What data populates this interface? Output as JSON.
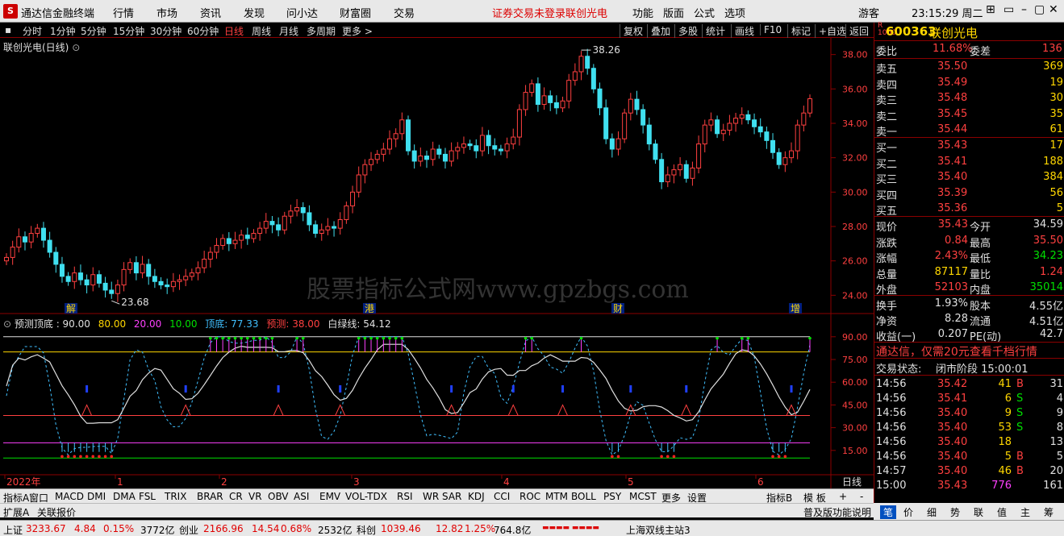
{
  "menubar": {
    "app_title": "通达信金融终端",
    "items": [
      "行情",
      "市场",
      "资讯",
      "发现",
      "问小达",
      "财富圈",
      "交易"
    ],
    "warning": "证券交易未登录",
    "warning_stock": "联创光电",
    "right_items": [
      "功能",
      "版面",
      "公式",
      "选项"
    ],
    "user": "游客",
    "clock": "23:15:29 周二",
    "win_buttons": [
      "⊞",
      "▭",
      "–",
      "▢",
      "✕"
    ]
  },
  "periodbar": {
    "periods": [
      "分时",
      "1分钟",
      "5分钟",
      "15分钟",
      "30分钟",
      "60分钟",
      "日线",
      "周线",
      "月线",
      "多周期",
      "更多 >"
    ],
    "active": "日线",
    "tools": [
      "复权",
      "叠加",
      "多股",
      "统计",
      "画线",
      "F10",
      "标记",
      "+自选",
      "返回"
    ]
  },
  "price_chart": {
    "title": "联创光电(日线)",
    "high_label": "38.26",
    "low_label": "23.68",
    "yaxis": [
      "38.00",
      "36.00",
      "34.00",
      "32.00",
      "30.00",
      "28.00",
      "26.00",
      "24.00"
    ],
    "markers": [
      "解",
      "港",
      "财",
      "增"
    ],
    "watermark": "股票指标公式网www.gpzbgs.com"
  },
  "indicator": {
    "name": "预测顶底",
    "legend": [
      {
        "text": "预测顶底 : 90.00",
        "color": "#e0e0e0"
      },
      {
        "text": "80.00",
        "color": "#ffd700"
      },
      {
        "text": "20.00",
        "color": "#ff40ff"
      },
      {
        "text": "10.00",
        "color": "#00e000"
      },
      {
        "text": "顶底: 77.33",
        "color": "#40c0ff"
      },
      {
        "text": "预测: 38.00",
        "color": "#ff4040"
      },
      {
        "text": "白绿线: 54.12",
        "color": "#e0e0e0"
      }
    ],
    "yaxis": [
      "90.00",
      "75.00",
      "60.00",
      "45.00",
      "30.00",
      "15.00"
    ]
  },
  "xaxis": {
    "labels": [
      "2022年",
      "1",
      "2",
      "3",
      "4",
      "5",
      "6"
    ],
    "period_label": "日线"
  },
  "ind_tabs": {
    "items": [
      "指标A",
      "窗口",
      "MACD",
      "DMI",
      "DMA",
      "FSL",
      "TRIX",
      "BRAR",
      "CR",
      "VR",
      "OBV",
      "ASI",
      "EMV",
      "VOL-TDX",
      "RSI",
      "WR",
      "SAR",
      "KDJ",
      "CCI",
      "ROC",
      "MTM",
      "BOLL",
      "PSY",
      "MCST",
      "更多",
      "设置"
    ],
    "right": [
      "指标B",
      "模 板",
      "+",
      "-"
    ]
  },
  "ext_bar": {
    "items": [
      "扩展A",
      "关联报价"
    ],
    "right": "普及版功能说明"
  },
  "quote_panel": {
    "badge_r": "R",
    "badge_num": "1000",
    "code": "600363",
    "name": "联创光电",
    "weibi_label": "委比",
    "weibi": "11.68%",
    "weicha_label": "委差",
    "weicha": "136",
    "asks": [
      {
        "label": "卖五",
        "price": "35.50",
        "vol": "369"
      },
      {
        "label": "卖四",
        "price": "35.49",
        "vol": "19"
      },
      {
        "label": "卖三",
        "price": "35.48",
        "vol": "30"
      },
      {
        "label": "卖二",
        "price": "35.45",
        "vol": "35"
      },
      {
        "label": "卖一",
        "price": "35.44",
        "vol": "61"
      }
    ],
    "bids": [
      {
        "label": "买一",
        "price": "35.43",
        "vol": "17"
      },
      {
        "label": "买二",
        "price": "35.41",
        "vol": "188"
      },
      {
        "label": "买三",
        "price": "35.40",
        "vol": "384"
      },
      {
        "label": "买四",
        "price": "35.39",
        "vol": "56"
      },
      {
        "label": "买五",
        "price": "35.36",
        "vol": "5"
      }
    ],
    "stats": [
      {
        "l1": "现价",
        "v1": "35.43",
        "c1": "red",
        "l2": "今开",
        "v2": "34.59",
        "c2": "wht"
      },
      {
        "l1": "涨跌",
        "v1": "0.84",
        "c1": "red",
        "l2": "最高",
        "v2": "35.50",
        "c2": "red"
      },
      {
        "l1": "涨幅",
        "v1": "2.43%",
        "c1": "red",
        "l2": "最低",
        "v2": "34.23",
        "c2": "grn"
      },
      {
        "l1": "总量",
        "v1": "87117",
        "c1": "yel",
        "l2": "量比",
        "v2": "1.24",
        "c2": "red"
      },
      {
        "l1": "外盘",
        "v1": "52103",
        "c1": "red",
        "l2": "内盘",
        "v2": "35014",
        "c2": "grn"
      }
    ],
    "stats2": [
      {
        "l1": "换手",
        "v1": "1.93%",
        "l2": "股本",
        "v2": "4.55亿"
      },
      {
        "l1": "净资",
        "v1": "8.28",
        "l2": "流通",
        "v2": "4.51亿"
      },
      {
        "l1": "收益(一)",
        "v1": "0.207",
        "l2": "PE(动)",
        "v2": "42.7"
      }
    ],
    "ad": "通达信，仅需20元查看千档行情",
    "trade_status_label": "交易状态:",
    "trade_status": "闭市阶段 15:00:01",
    "ticks": [
      {
        "t": "14:56",
        "p": "35.42",
        "v": "41",
        "d": "B",
        "n": "31"
      },
      {
        "t": "14:56",
        "p": "35.41",
        "v": "6",
        "d": "S",
        "n": "4"
      },
      {
        "t": "14:56",
        "p": "35.40",
        "v": "9",
        "d": "S",
        "n": "9"
      },
      {
        "t": "14:56",
        "p": "35.40",
        "v": "53",
        "d": "S",
        "n": "8"
      },
      {
        "t": "14:56",
        "p": "35.40",
        "v": "18",
        "d": "",
        "n": "13"
      },
      {
        "t": "14:56",
        "p": "35.40",
        "v": "5",
        "d": "B",
        "n": "5"
      },
      {
        "t": "14:57",
        "p": "35.40",
        "v": "46",
        "d": "B",
        "n": "20"
      },
      {
        "t": "15:00",
        "p": "35.43",
        "v": "776",
        "d": "",
        "n": "161"
      }
    ],
    "bottom_tabs": [
      "笔",
      "价",
      "细",
      "势",
      "联",
      "值",
      "主",
      "筹"
    ]
  },
  "status_bar": {
    "sh_label": "上证",
    "sh_val": "3233.67",
    "sh_chg": "4.84",
    "sh_pct": "0.15%",
    "sh_amt": "3772亿",
    "cy_label": "创业",
    "cy_val": "2166.96",
    "cy_chg": "14.54",
    "cy_pct": "0.68%",
    "cy_amt": "2532亿",
    "kc_label": "科创",
    "kc_val": "1039.46",
    "kc_chg": "12.82",
    "kc_pct": "1.25%",
    "kc_amt": "764.8亿",
    "server": "上海双线主站3"
  },
  "colors": {
    "up": "#ff4040",
    "down": "#40e0f0",
    "bg": "#000000",
    "grid": "#8b0000"
  },
  "chart_data": {
    "type": "candlestick",
    "title": "联创光电(日线)",
    "ylim": [
      23.5,
      38.5
    ],
    "high": 38.26,
    "low": 23.68,
    "close_series": [
      26.2,
      26.8,
      27.4,
      27.1,
      27.6,
      27.9,
      27.2,
      26.5,
      25.8,
      25.1,
      24.8,
      25.3,
      24.9,
      24.6,
      25.2,
      24.7,
      24.3,
      24.1,
      24.6,
      25.5,
      25.9,
      25.3,
      25.8,
      25.1,
      24.8,
      24.6,
      24.5,
      24.8,
      24.9,
      25.1,
      25.3,
      25.6,
      26.1,
      26.5,
      26.9,
      27.3,
      27.0,
      27.2,
      27.5,
      27.3,
      27.6,
      27.9,
      28.3,
      28.1,
      27.8,
      28.6,
      28.9,
      29.1,
      28.8,
      28.1,
      27.6,
      27.8,
      28.0,
      27.9,
      28.4,
      29.2,
      30.0,
      31.0,
      31.6,
      31.9,
      32.2,
      32.5,
      33.1,
      33.4,
      34.2,
      32.4,
      31.8,
      32.1,
      31.9,
      32.5,
      32.2,
      31.8,
      32.4,
      32.6,
      32.8,
      32.7,
      32.4,
      33.3,
      32.7,
      32.5,
      32.4,
      32.8,
      33.2,
      34.8,
      35.8,
      36.3,
      35.1,
      35.6,
      35.2,
      34.9,
      35.3,
      36.5,
      37.0,
      37.9,
      37.2,
      36.0,
      34.9,
      33.1,
      32.5,
      33.1,
      34.6,
      35.4,
      34.8,
      33.9,
      32.8,
      31.9,
      30.6,
      31.0,
      31.3,
      31.6,
      30.8,
      31.4,
      32.8,
      33.9,
      34.2,
      33.4,
      33.6,
      34.0,
      34.3,
      34.5,
      34.2,
      33.8,
      33.5,
      33.0,
      32.3,
      31.6,
      32.0,
      32.4,
      33.9,
      34.6,
      35.43
    ]
  }
}
